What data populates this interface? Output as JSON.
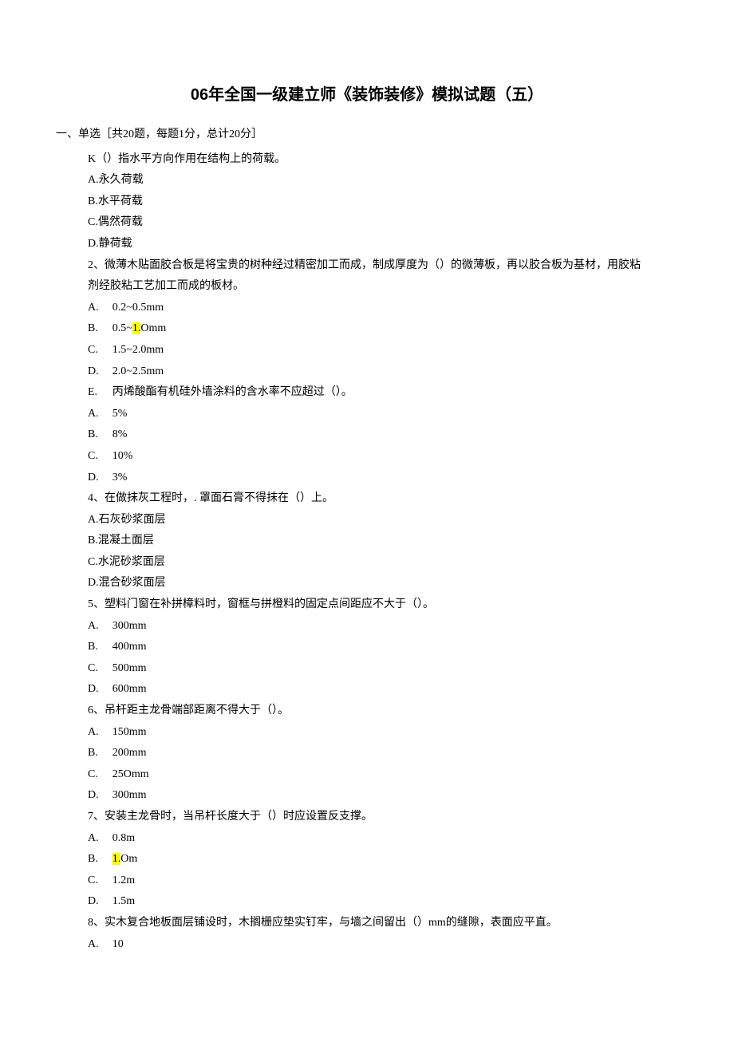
{
  "title_prefix": "06",
  "title_rest": "年全国一级建立师《装饰装修》模拟试题（五）",
  "section1": "一、单选［共20题，每题1分，总计20分］",
  "q1": {
    "stem": "K（）指水平方向作用在结构上的荷载。",
    "a": "A.永久荷载",
    "b": "B.水平荷载",
    "c": "C.偶然荷载",
    "d": "D.静荷载"
  },
  "q2": {
    "stem": "2、微薄木贴面胶合板是将宝贵的树种经过精密加工而成，制成厚度为（）的微薄板，再以胶合板为基材，用胶粘剂经胶粘工艺加工而成的板材。",
    "a_label": "A.",
    "a_val": "0.2~0.5mm",
    "b_label": "B.",
    "b_pre": "0.5~",
    "b_hl": "1.",
    "b_post": "Omm",
    "c_label": "C.",
    "c_val": "1.5~2.0mm",
    "d_label": "D.",
    "d_val": "2.0~2.5mm",
    "e_label": "E.",
    "e_val": "丙烯酸酯有机硅外墙涂料的含水率不应超过（）。",
    "ea_label": "A.",
    "ea_val": "5%",
    "eb_label": "B.",
    "eb_val": "8%",
    "ec_label": "C.",
    "ec_val": "10%",
    "ed_label": "D.",
    "ed_val": "3%"
  },
  "q4": {
    "stem": "4、在做抹灰工程时，. 罩面石膏不得抹在（）上。",
    "a": "A.石灰砂浆面层",
    "b": "B.混凝土面层",
    "c": "C.水泥砂浆面层",
    "d": "D.混合砂浆面层"
  },
  "q5": {
    "stem": "5、塑料门窗在补拼樟料时，窗框与拼橙料的固定点间距应不大于（）。",
    "a_label": "A.",
    "a_val": "300mm",
    "b_label": "B.",
    "b_val": "400mm",
    "c_label": "C.",
    "c_val": "500mm",
    "d_label": "D.",
    "d_val": "600mm"
  },
  "q6": {
    "stem": "6、吊杆距主龙骨端部距离不得大于（）。",
    "a_label": "A.",
    "a_val": "150mm",
    "b_label": "B.",
    "b_val": "200mm",
    "c_label": "C.",
    "c_val": "25Omm",
    "d_label": "D.",
    "d_val": "300mm"
  },
  "q7": {
    "stem": "7、安装主龙骨时，当吊杆长度大于（）时应设置反支撑。",
    "a_label": "A.",
    "a_val": "0.8m",
    "b_label": "B.",
    "b_hl": "1.",
    "b_post": "Om",
    "c_label": "C.",
    "c_val": "1.2m",
    "d_label": "D.",
    "d_val": "1.5m"
  },
  "q8": {
    "stem": "8、实木复合地板面层铺设时，木搁栅应垫实钉牢，与墙之间留出（）mm的缝隙，表面应平直。",
    "a_label": "A.",
    "a_val": "10"
  }
}
